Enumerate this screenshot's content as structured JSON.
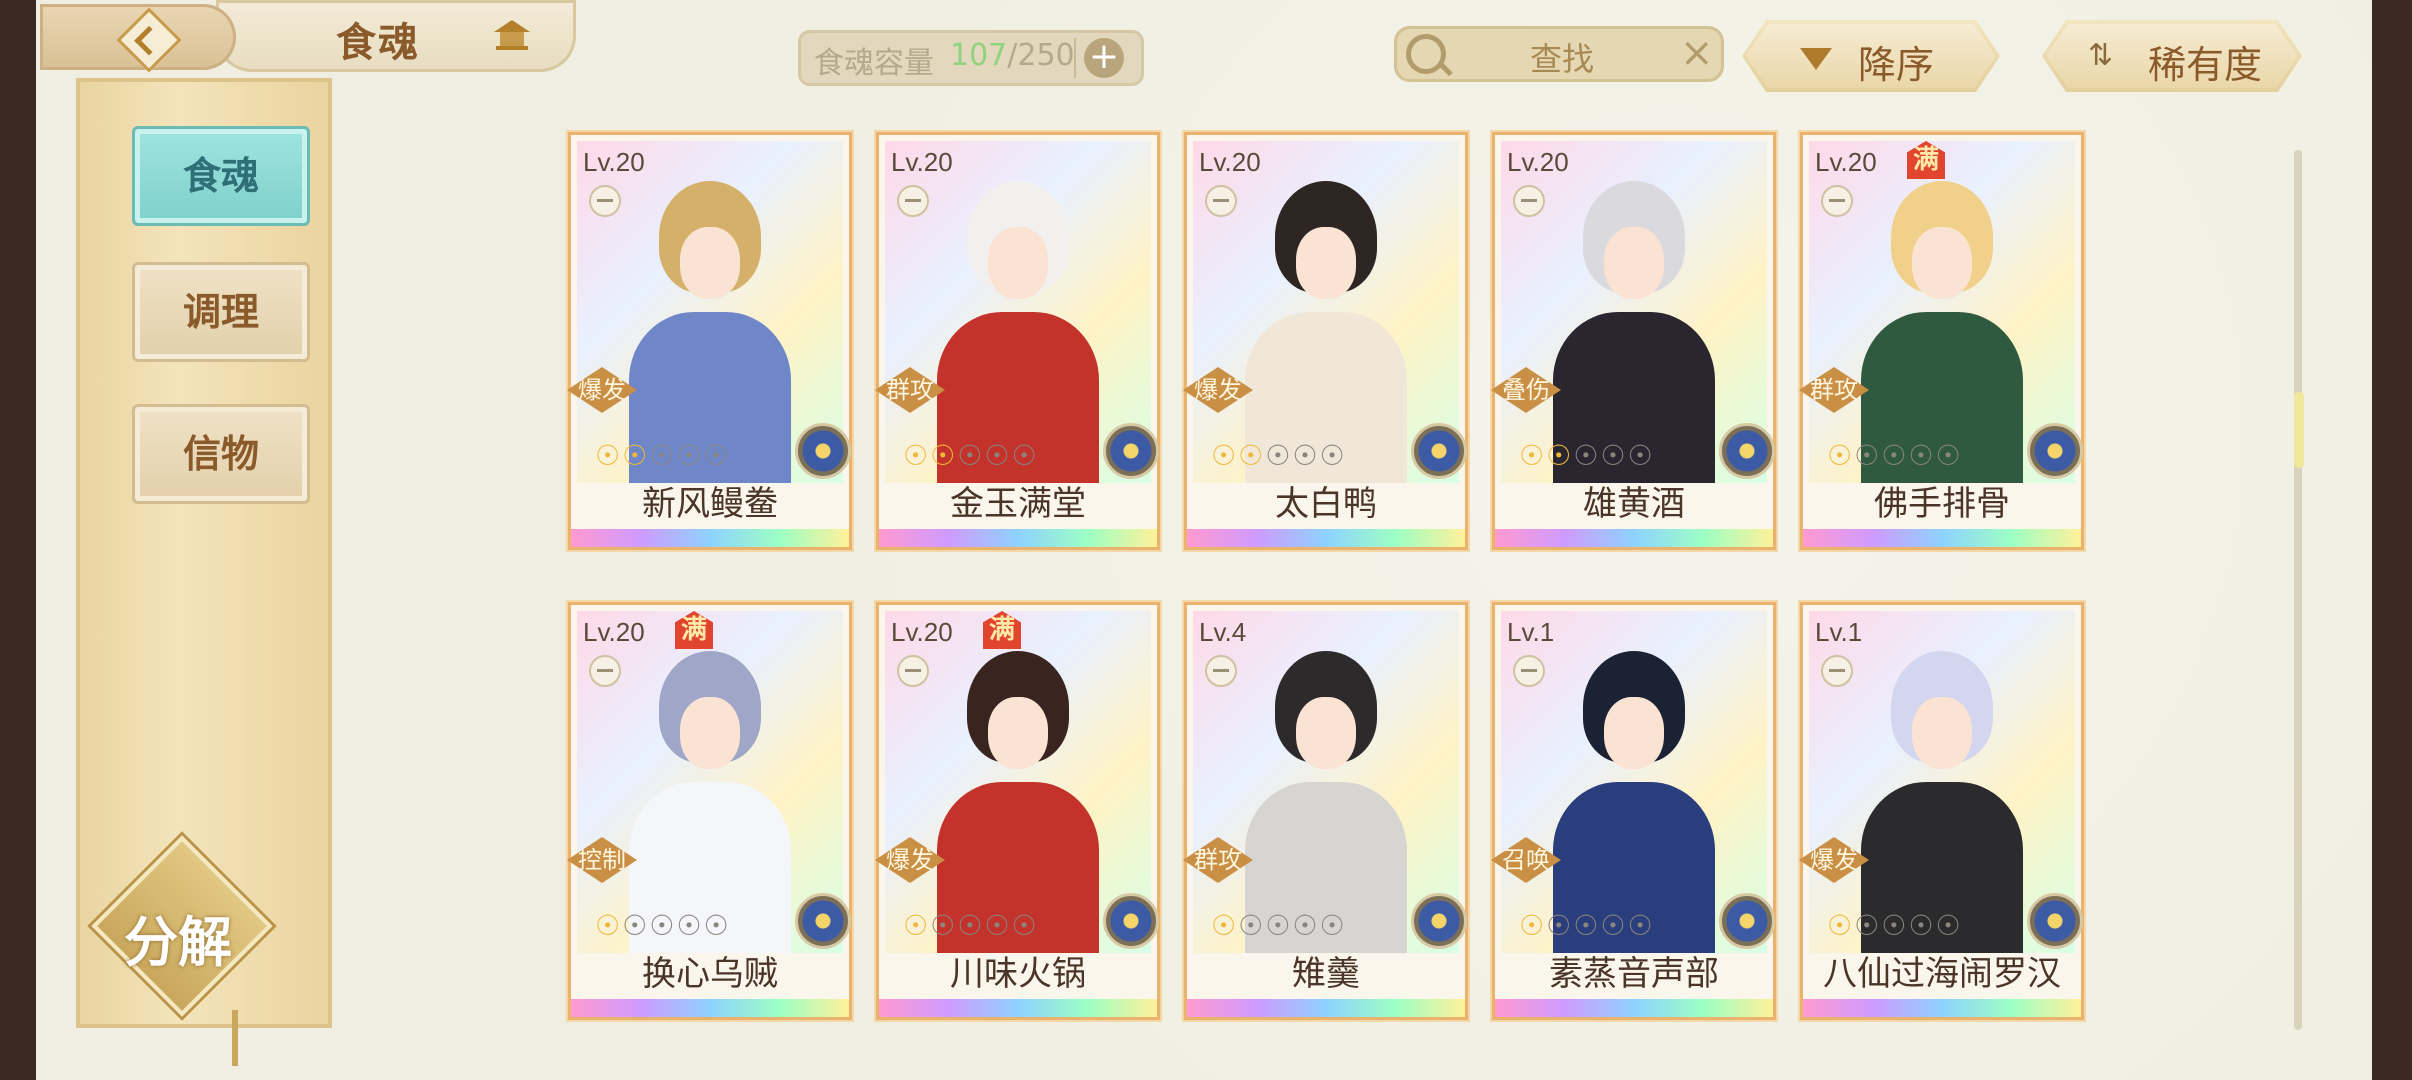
{
  "header": {
    "title": "食魂",
    "capacity": {
      "label": "食魂容量",
      "current": "107",
      "total": "/250"
    },
    "search": {
      "placeholder": "查找"
    },
    "sort": {
      "order_label": "降序",
      "rarity_label": "稀有度"
    }
  },
  "sidebar": {
    "items": [
      {
        "label": "食魂",
        "active": true
      },
      {
        "label": "调理",
        "active": false
      },
      {
        "label": "信物",
        "active": false
      }
    ],
    "decompose_label": "分解"
  },
  "cards": [
    {
      "level": "Lv.20",
      "name": "新风鳗鲞",
      "role": "爆发",
      "stars_on": 2,
      "full": false,
      "palette": [
        "#d5b06a",
        "#6f86c9"
      ]
    },
    {
      "level": "Lv.20",
      "name": "金玉满堂",
      "role": "群攻",
      "stars_on": 2,
      "full": false,
      "palette": [
        "#f1f0ee",
        "#c3322b"
      ]
    },
    {
      "level": "Lv.20",
      "name": "太白鸭",
      "role": "爆发",
      "stars_on": 2,
      "full": false,
      "palette": [
        "#2e2622",
        "#f0e7d8"
      ]
    },
    {
      "level": "Lv.20",
      "name": "雄黄酒",
      "role": "叠伤",
      "stars_on": 2,
      "full": false,
      "palette": [
        "#d9d9de",
        "#2a2630"
      ]
    },
    {
      "level": "Lv.20",
      "name": "佛手排骨",
      "role": "群攻",
      "stars_on": 1,
      "full": true,
      "palette": [
        "#f0d08a",
        "#2f5a3f"
      ]
    },
    {
      "level": "Lv.20",
      "name": "换心乌贼",
      "role": "控制",
      "stars_on": 1,
      "full": true,
      "palette": [
        "#9fa6c7",
        "#f4f6fa"
      ]
    },
    {
      "level": "Lv.20",
      "name": "川味火锅",
      "role": "爆发",
      "stars_on": 1,
      "full": true,
      "palette": [
        "#3a2420",
        "#c3322b"
      ]
    },
    {
      "level": "Lv.4",
      "name": "雉羹",
      "role": "群攻",
      "stars_on": 1,
      "full": false,
      "palette": [
        "#2d2a2b",
        "#d7d5d2"
      ]
    },
    {
      "level": "Lv.1",
      "name": "素蒸音声部",
      "role": "召唤",
      "stars_on": 1,
      "full": false,
      "palette": [
        "#1b2233",
        "#2a3d7d"
      ]
    },
    {
      "level": "Lv.1",
      "name": "八仙过海闹罗汉",
      "role": "爆发",
      "stars_on": 1,
      "full": false,
      "palette": [
        "#d3d6ee",
        "#2b2a2c"
      ]
    }
  ],
  "full_badge": "满",
  "total_stars": 5
}
